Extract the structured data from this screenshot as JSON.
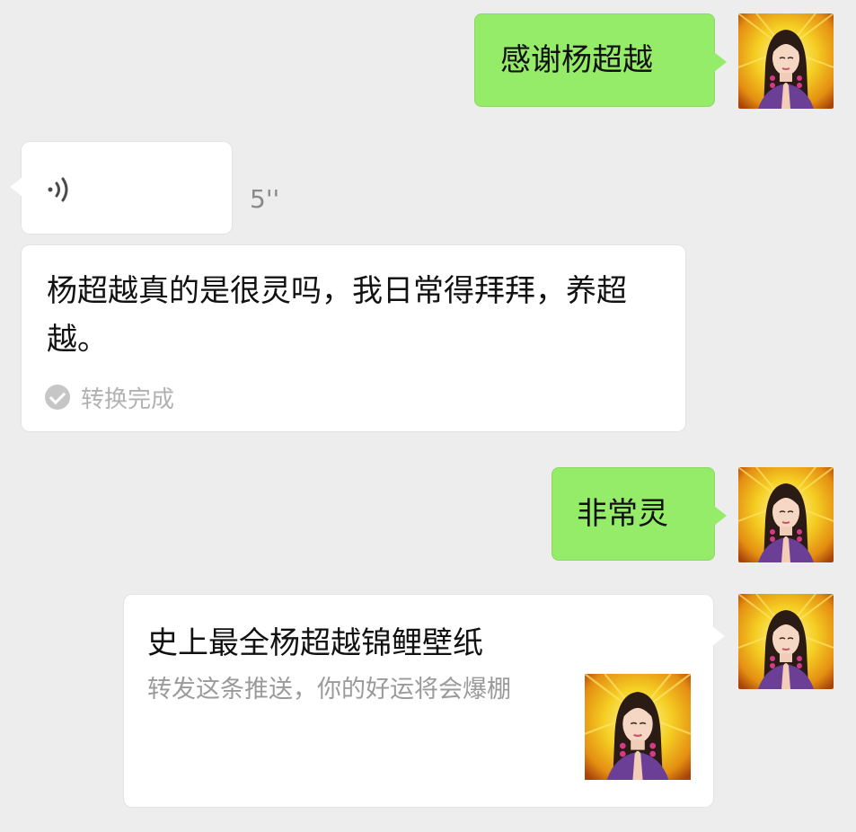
{
  "messages": {
    "sent_1": "感谢杨超越",
    "voice_duration": "5''",
    "transcription_text": "杨超越真的是很灵吗，我日常得拜拜，养超越。",
    "transcription_status": "转换完成",
    "sent_2": "非常灵",
    "card_title": "史上最全杨超越锦鲤壁纸",
    "card_desc": "转发这条推送，你的好运将会爆棚"
  },
  "colors": {
    "background": "#ededed",
    "sent_bubble": "#95ec69",
    "received_bubble": "#ffffff",
    "secondary_text": "#9a9a9a"
  },
  "icons": {
    "voice": "voice-wave-icon",
    "check": "check-circle-icon"
  }
}
